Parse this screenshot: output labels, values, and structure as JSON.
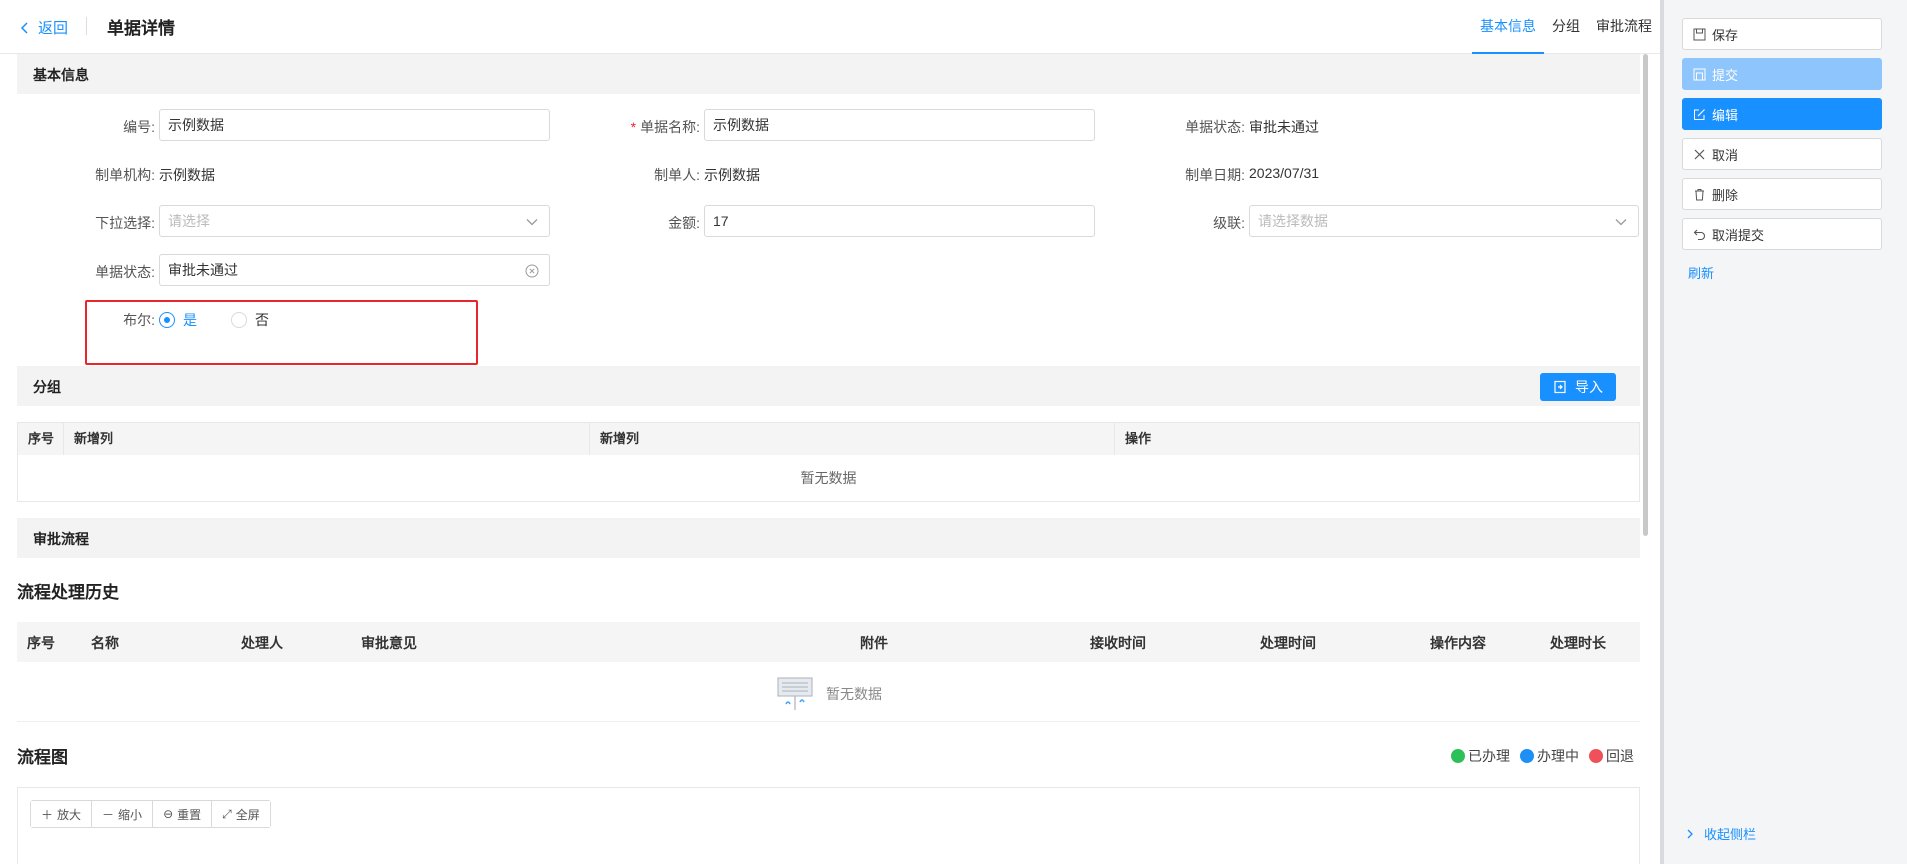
{
  "header": {
    "back_label": "返回",
    "title": "单据详情",
    "tabs": [
      "基本信息",
      "分组",
      "审批流程"
    ]
  },
  "basic": {
    "section_title": "基本信息",
    "fields": {
      "code_label": "编号:",
      "code_value": "示例数据",
      "name_label": "单据名称:",
      "name_value": "示例数据",
      "status_label": "单据状态:",
      "status_value": "审批未通过",
      "org_label": "制单机构:",
      "org_value": "示例数据",
      "maker_label": "制单人:",
      "maker_value": "示例数据",
      "date_label": "制单日期:",
      "date_value": "2023/07/31",
      "dropdown_label": "下拉选择:",
      "dropdown_placeholder": "请选择",
      "amount_label": "金额:",
      "amount_value": "17",
      "cascade_label": "级联:",
      "cascade_placeholder": "请选择数据",
      "status2_label": "单据状态:",
      "status2_value": "审批未通过",
      "bool_label": "布尔:",
      "bool_yes": "是",
      "bool_no": "否",
      "bool_selected": "是"
    }
  },
  "group": {
    "section_title": "分组",
    "import_label": "导入",
    "columns": [
      "序号",
      "新增列",
      "新增列",
      "操作"
    ],
    "empty_text": "暂无数据"
  },
  "approval": {
    "section_title": "审批流程",
    "history_title": "流程处理历史",
    "columns": [
      "序号",
      "名称",
      "处理人",
      "审批意见",
      "附件",
      "接收时间",
      "处理时间",
      "操作内容",
      "处理时长"
    ],
    "empty_text": "暂无数据",
    "chart_title": "流程图",
    "legend": [
      {
        "label": "已办理",
        "color": "#2dbf58"
      },
      {
        "label": "办理中",
        "color": "#1e8ff5"
      },
      {
        "label": "回退",
        "color": "#f0505a"
      }
    ],
    "toolbar": [
      "放大",
      "缩小",
      "重置",
      "全屏"
    ]
  },
  "sidebar": {
    "buttons": [
      "保存",
      "提交",
      "编辑",
      "取消",
      "删除",
      "取消提交"
    ],
    "refresh": "刷新",
    "collapse": "收起侧栏"
  },
  "colors": {
    "primary": "#1890ff",
    "highlight": "#e8262d"
  }
}
